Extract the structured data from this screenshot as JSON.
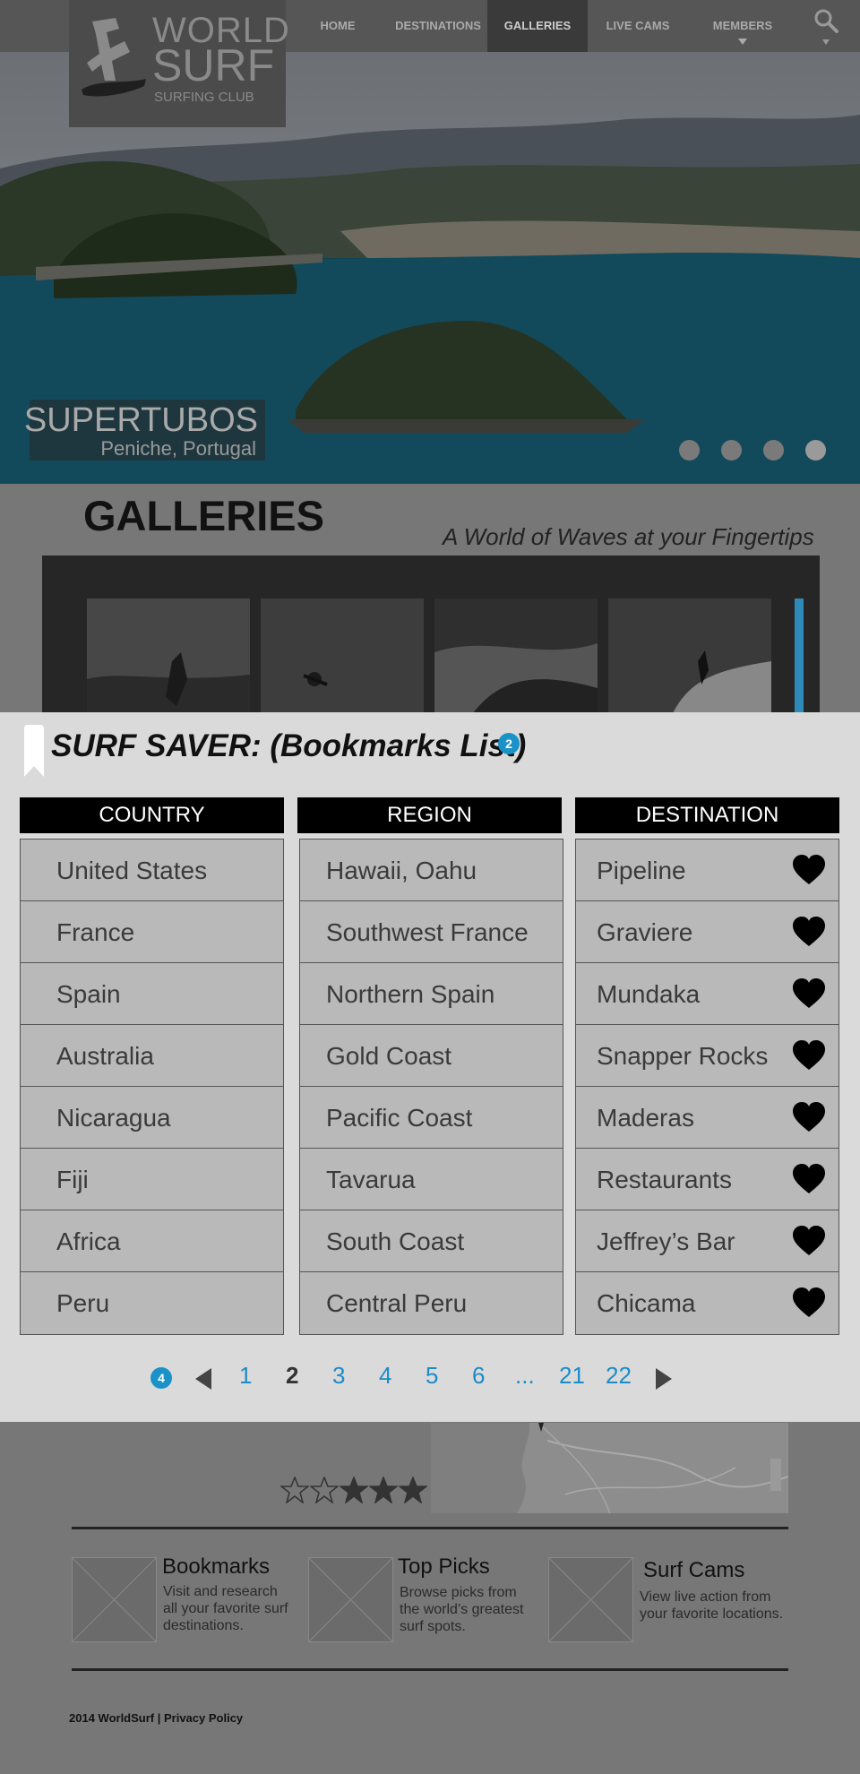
{
  "nav": {
    "items": [
      {
        "label": "HOME"
      },
      {
        "label": "DESTINATIONS"
      },
      {
        "label": "GALLERIES"
      },
      {
        "label": "LIVE CAMS"
      },
      {
        "label": "MEMBERS"
      }
    ]
  },
  "logo": {
    "line1": "WORLD",
    "line2": "SURF",
    "line3": "SURFING CLUB"
  },
  "hero": {
    "title": "SUPERTUBOS",
    "location": "Peniche, Portugal"
  },
  "galleries": {
    "title": "GALLERIES",
    "subtitle": "A World of  Waves at your Fingertips"
  },
  "bookmarks": {
    "title": "SURF SAVER: (Bookmarks List)",
    "badge": "2",
    "headers": {
      "country": "COUNTRY",
      "region": "REGION",
      "destination": "DESTINATION"
    },
    "countries": [
      "United States",
      "France",
      "Spain",
      "Australia",
      "Nicaragua",
      "Fiji",
      "Africa",
      "Peru"
    ],
    "regions": [
      "Hawaii, Oahu",
      "Southwest France",
      "Northern Spain",
      "Gold Coast",
      "Pacific Coast",
      "Tavarua",
      "South Coast",
      "Central Peru"
    ],
    "destinations": [
      "Pipeline",
      "Graviere",
      "Mundaka",
      "Snapper Rocks",
      "Maderas",
      "Restaurants",
      "Jeffrey’s Bar",
      "Chicama"
    ]
  },
  "pagination": {
    "badge": "4",
    "pages": [
      "1",
      "2",
      "3",
      "4",
      "5",
      "6",
      "...",
      "21",
      "22"
    ],
    "current": "2"
  },
  "rating": {
    "value": 3,
    "max": 5
  },
  "features": [
    {
      "title": "Bookmarks",
      "desc": [
        "Visit and research",
        "all your favorite surf",
        "destinations."
      ]
    },
    {
      "title": "Top Picks",
      "desc": [
        "Browse picks from",
        "the world’s greatest",
        "surf spots."
      ]
    },
    {
      "title": "Surf Cams",
      "desc": [
        "View live action from",
        "your favorite locations."
      ]
    }
  ],
  "footer": {
    "text": "2014 WorldSurf | Privacy Policy"
  },
  "colors": {
    "accent": "#1b92c7",
    "link": "#1b8cc8"
  },
  "icons": [
    "search-icon",
    "bookmark-icon",
    "heart-icon",
    "prev-arrow-icon",
    "next-arrow-icon",
    "star-icon",
    "placeholder-image-icon"
  ]
}
